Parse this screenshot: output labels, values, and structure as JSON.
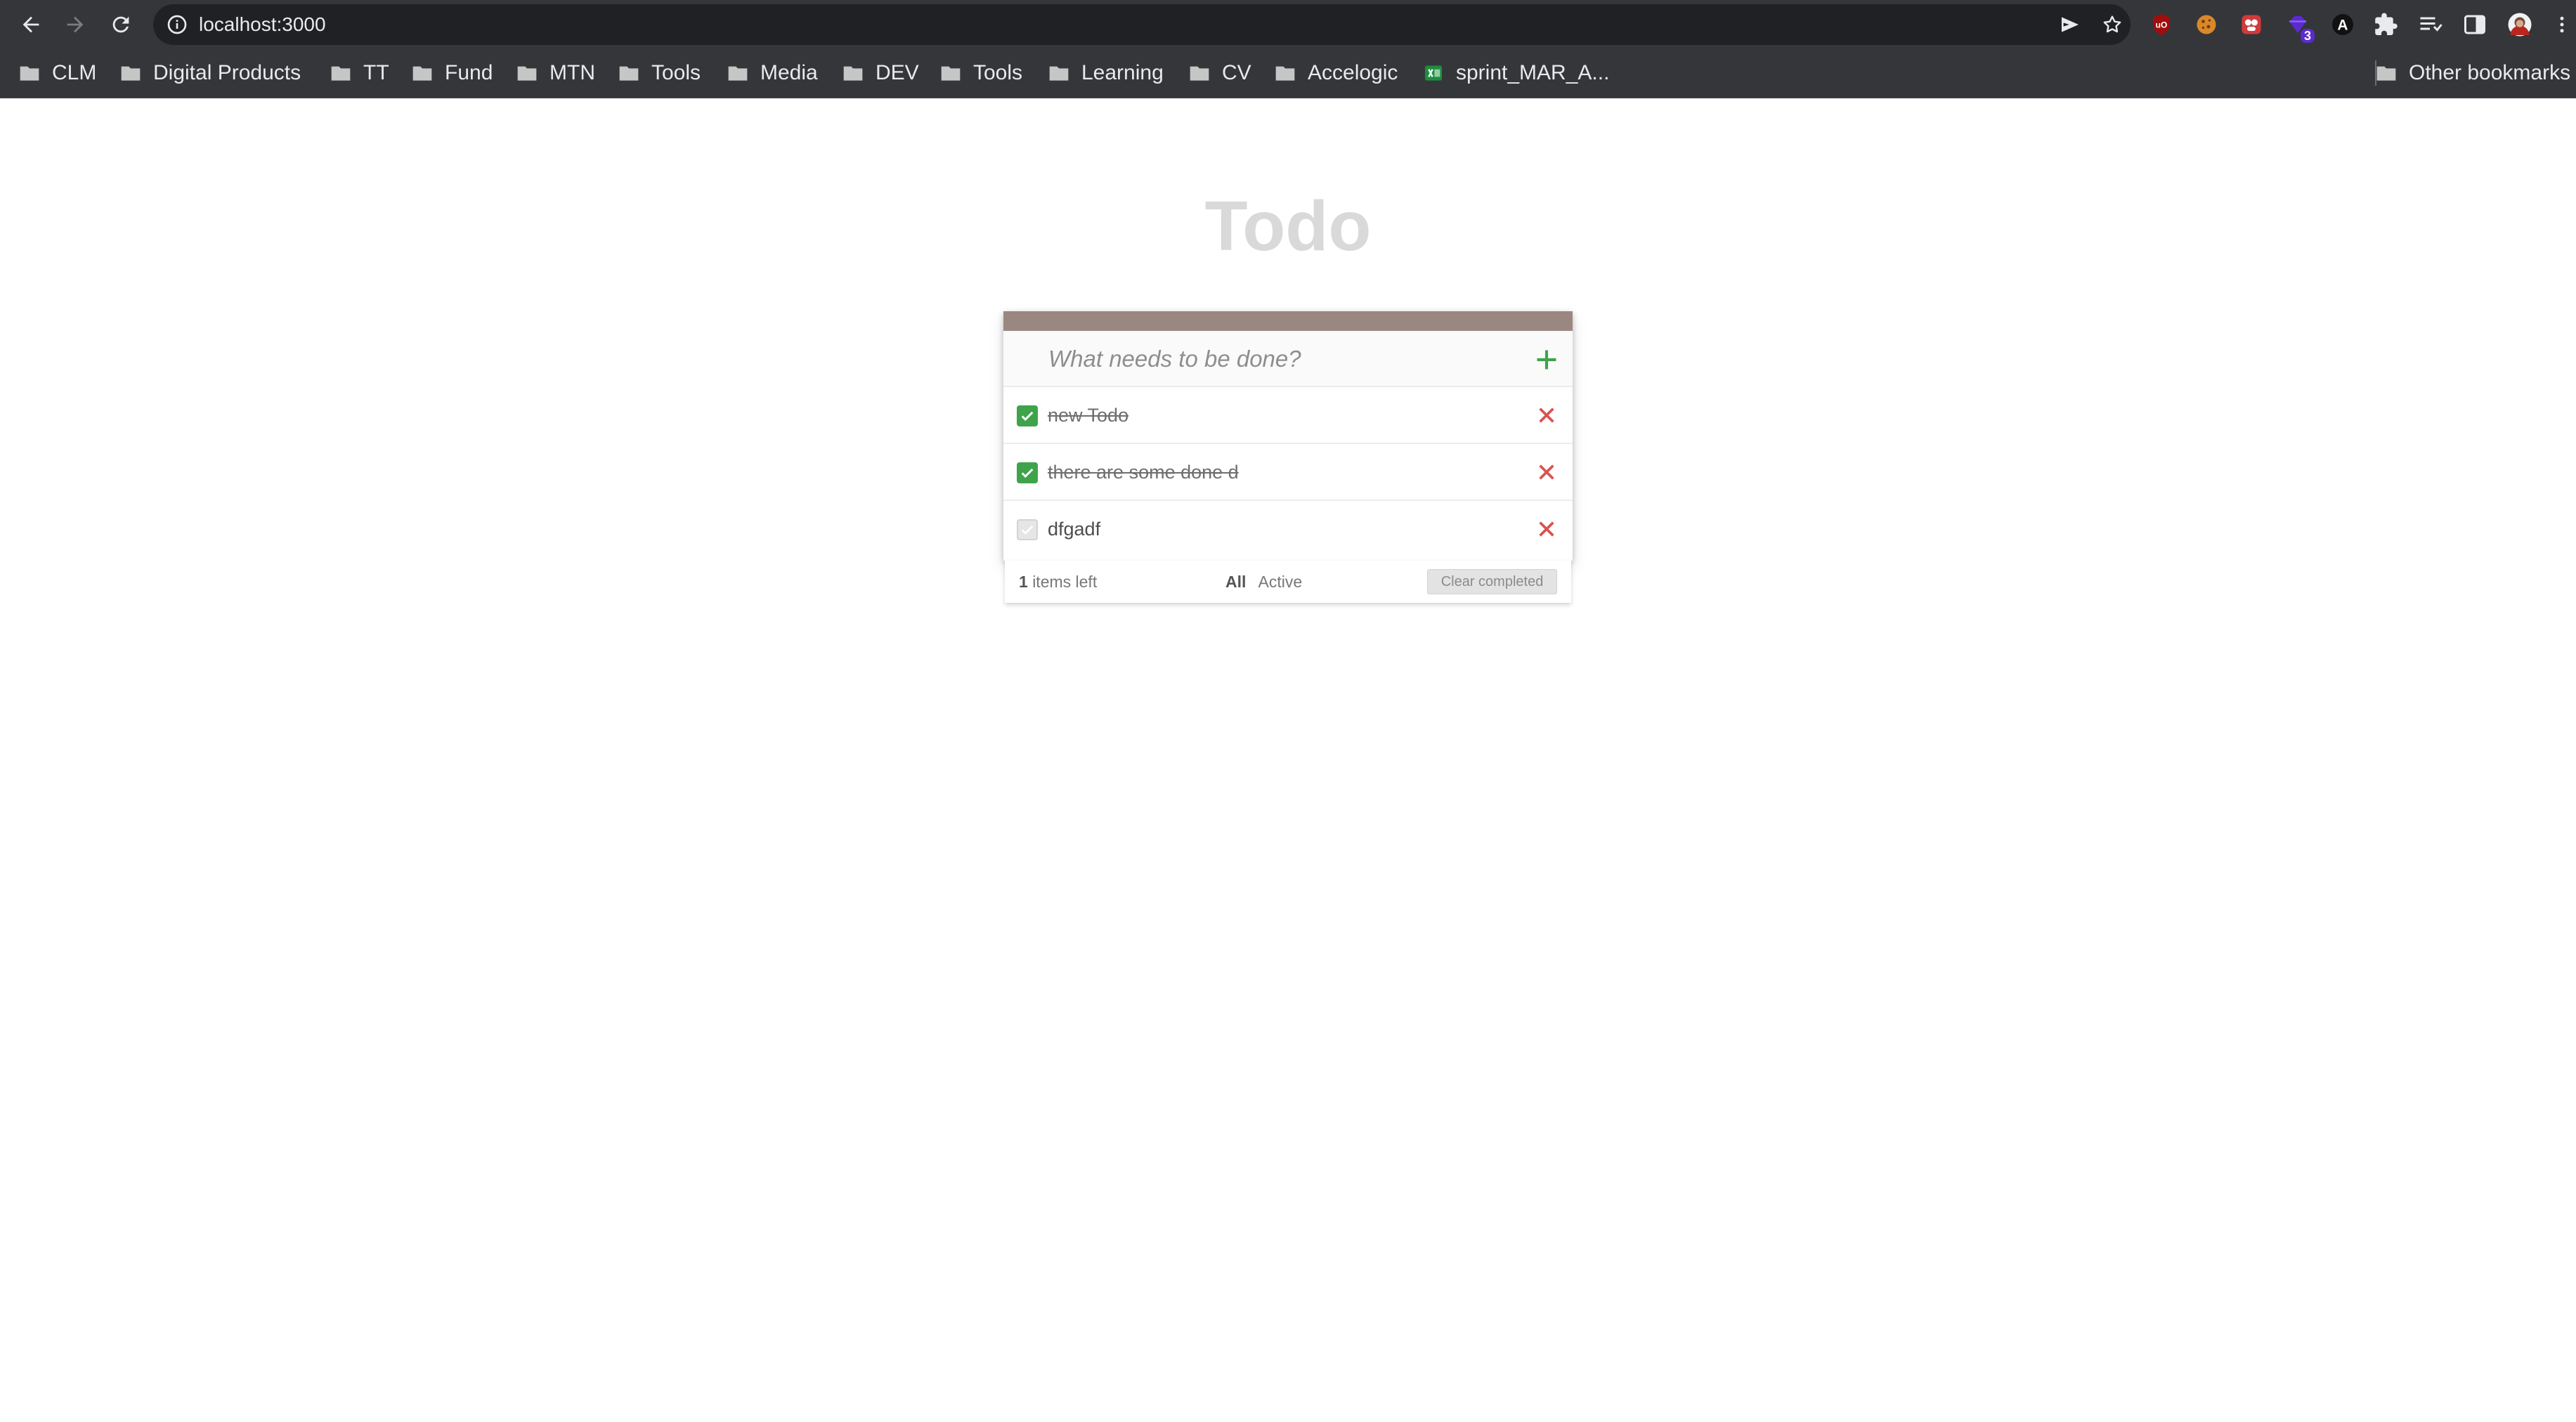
{
  "browser": {
    "url": "localhost:3000",
    "extensions": [
      {
        "name": "ublock-origin-icon",
        "color": "#a00d0d"
      },
      {
        "name": "cookie-icon",
        "color": "#d9882a"
      },
      {
        "name": "puzzle-red-icon",
        "color": "#d23a3a"
      },
      {
        "name": "gem-extension-icon",
        "color": "#5b2bd0",
        "badge": "3"
      },
      {
        "name": "a-extension-icon",
        "color": "#202124"
      },
      {
        "name": "extensions-icon",
        "color": "#e8eaed"
      }
    ],
    "bookmarks": [
      {
        "label": "CLM",
        "type": "folder"
      },
      {
        "label": "Digital Products",
        "type": "folder"
      },
      {
        "label": "TT",
        "type": "folder"
      },
      {
        "label": "Fund",
        "type": "folder"
      },
      {
        "label": "MTN",
        "type": "folder"
      },
      {
        "label": "Tools",
        "type": "folder"
      },
      {
        "label": "Media",
        "type": "folder"
      },
      {
        "label": "DEV",
        "type": "folder"
      },
      {
        "label": "Tools",
        "type": "folder"
      },
      {
        "label": "Learning",
        "type": "folder"
      },
      {
        "label": "CV",
        "type": "folder"
      },
      {
        "label": "Accelogic",
        "type": "folder"
      },
      {
        "label": "sprint_MAR_A...",
        "type": "sheet"
      }
    ],
    "other_bookmarks": "Other bookmarks"
  },
  "app": {
    "title": "Todo",
    "new_todo": {
      "placeholder": "What needs to be done?",
      "value": ""
    },
    "todos": [
      {
        "text": "new Todo",
        "completed": true
      },
      {
        "text": "there are some done d",
        "completed": true
      },
      {
        "text": "dfgadf",
        "completed": false
      }
    ],
    "footer": {
      "count": "1",
      "count_suffix": "items left",
      "filters": [
        {
          "label": "All",
          "selected": true
        },
        {
          "label": "Active",
          "selected": false
        }
      ],
      "clear_label": "Clear completed"
    },
    "colors": {
      "accent_bar": "#9b8781",
      "check_green": "#3ea34b",
      "add_green": "#3ea34b",
      "delete_red": "#d9534f",
      "title_gray": "#d9d9d9"
    }
  }
}
